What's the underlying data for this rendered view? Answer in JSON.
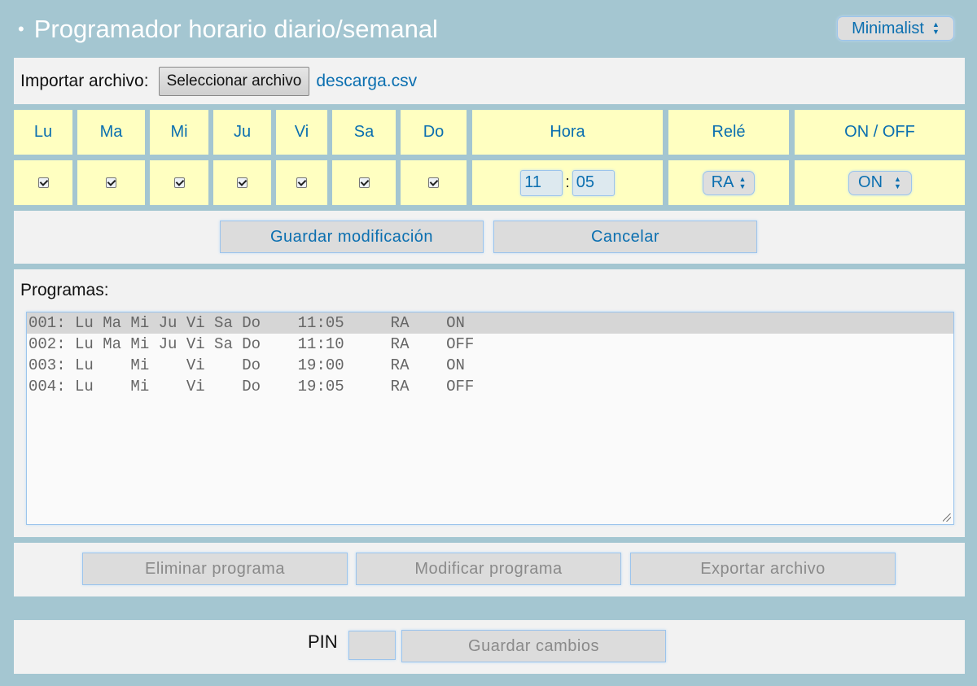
{
  "header": {
    "title": "Programador horario diario/semanal",
    "bullet": "•",
    "theme": "Minimalist"
  },
  "import": {
    "label": "Importar archivo:",
    "button": "Seleccionar archivo",
    "filename": "descarga.csv"
  },
  "schedule": {
    "days": [
      "Lu",
      "Ma",
      "Mi",
      "Ju",
      "Vi",
      "Sa",
      "Do"
    ],
    "days_checked": [
      true,
      true,
      true,
      true,
      true,
      true,
      true
    ],
    "hour_header": "Hora",
    "relay_header": "Relé",
    "onoff_header": "ON / OFF",
    "hour": "11",
    "minute": "05",
    "separator": ":",
    "relay": "RA",
    "state": "ON"
  },
  "edit_buttons": {
    "save": "Guardar modificación",
    "cancel": "Cancelar"
  },
  "programs": {
    "label": "Programas:",
    "rows": [
      "001: Lu Ma Mi Ju Vi Sa Do    11:05     RA    ON",
      "002: Lu Ma Mi Ju Vi Sa Do    11:10     RA    OFF",
      "003: Lu    Mi    Vi    Do    19:00     RA    ON",
      "004: Lu    Mi    Vi    Do    19:05     RA    OFF"
    ]
  },
  "program_buttons": {
    "delete": "Eliminar programa",
    "modify": "Modificar programa",
    "export": "Exportar archivo"
  },
  "pin": {
    "label": "PIN",
    "value": "",
    "save": "Guardar cambios"
  },
  "colors": {
    "background": "#a4c6d1",
    "panel": "#f2f2f2",
    "cell": "#ffffc1",
    "accent": "#0b6fb0",
    "disabled_text": "#8a8a8a"
  },
  "icons": {
    "select_arrows": "updown-arrows-icon",
    "checkbox": "checkmark-icon",
    "resize": "resize-grip-icon"
  }
}
